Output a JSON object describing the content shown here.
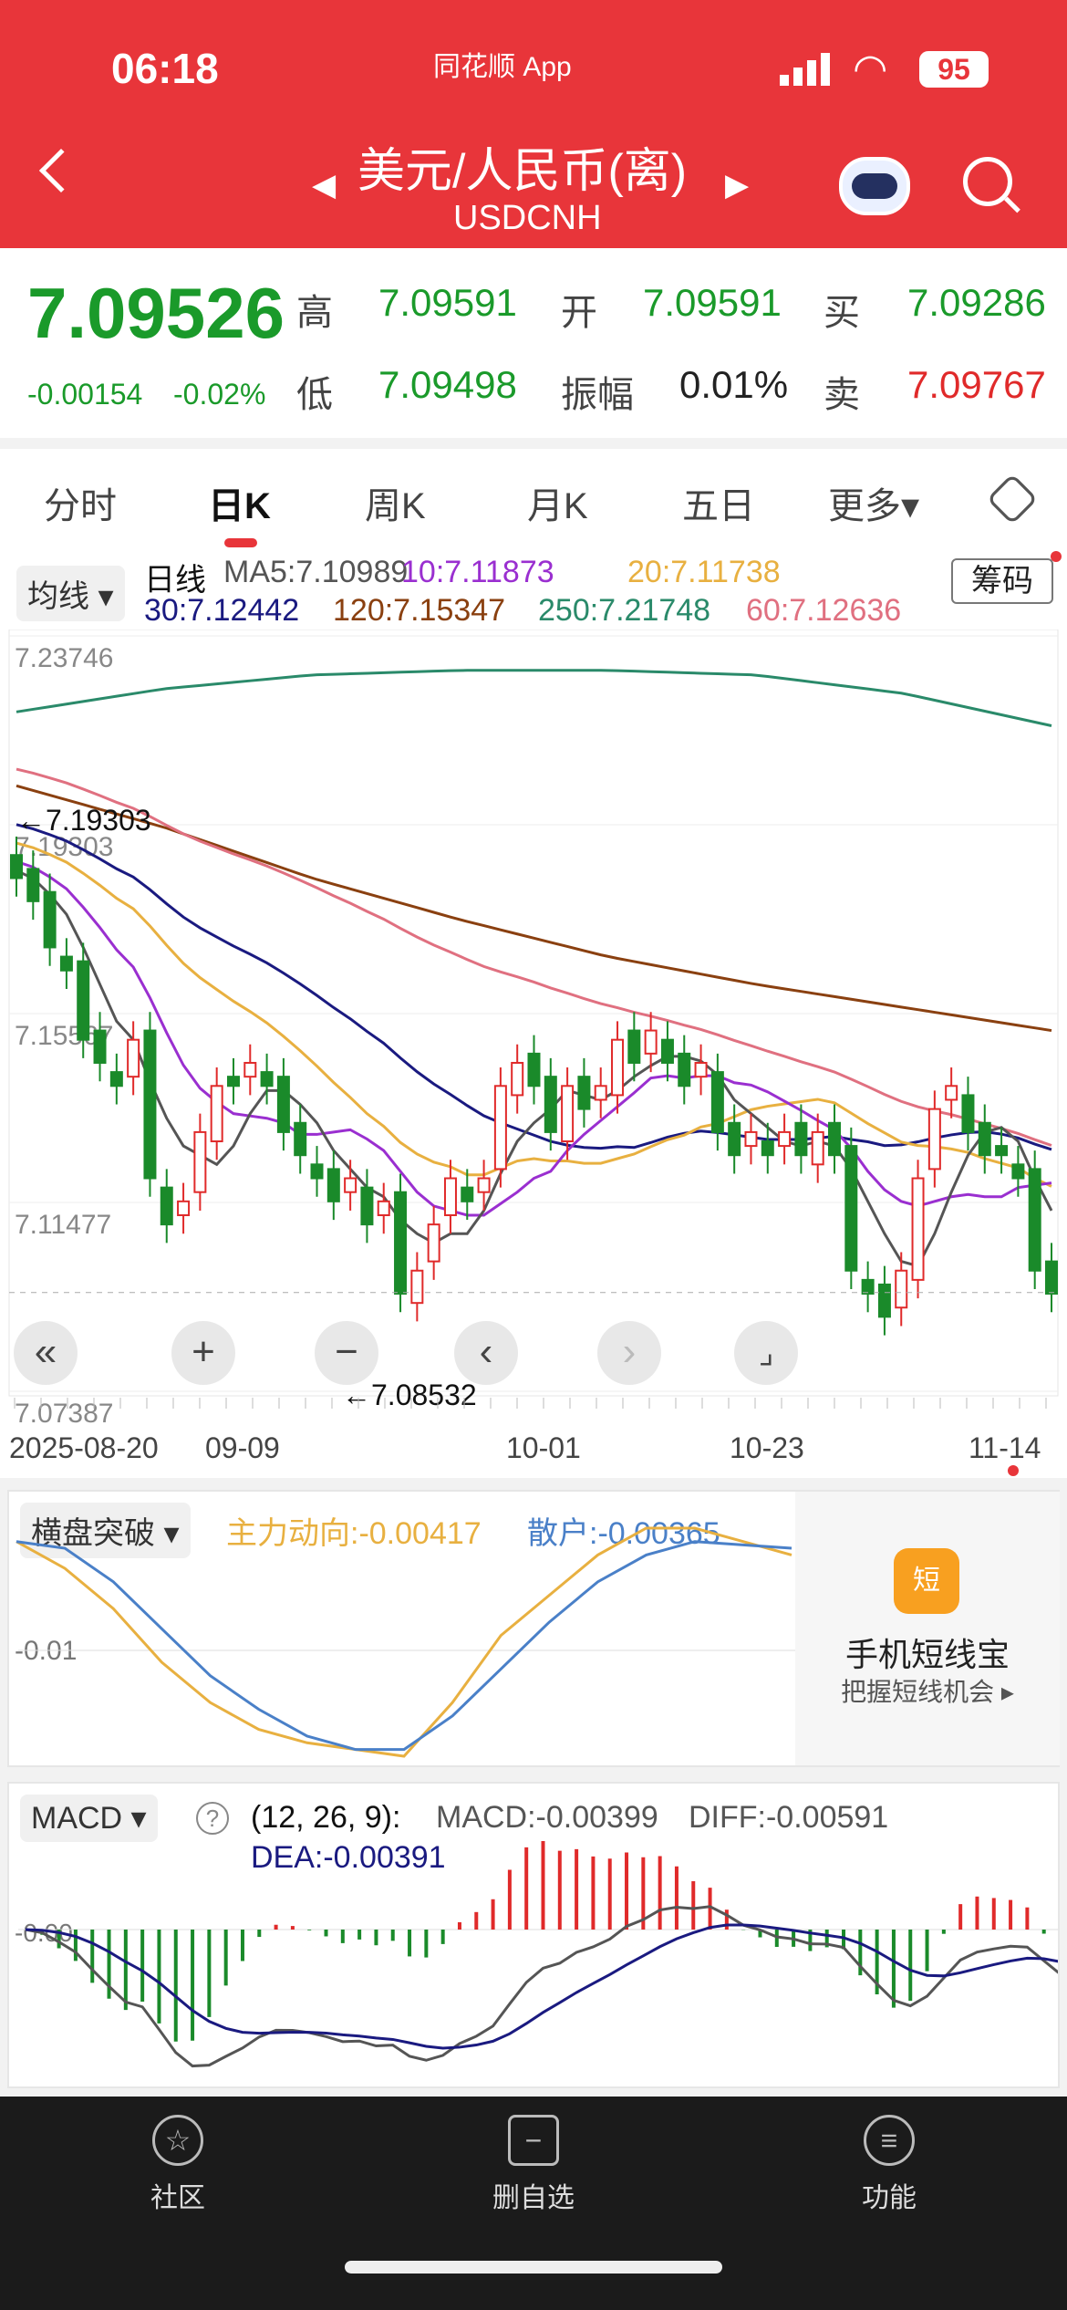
{
  "status": {
    "time": "06:18",
    "app": "同花顺 App",
    "battery": "95"
  },
  "header": {
    "title": "美元/人民币(离)",
    "code": "USDCNH"
  },
  "quote": {
    "price": "7.09526",
    "change": "-0.00154",
    "pct": "-0.02%",
    "high_label": "高",
    "high": "7.09591",
    "open_label": "开",
    "open": "7.09591",
    "bid_label": "买",
    "bid": "7.09286",
    "low_label": "低",
    "low": "7.09498",
    "amp_label": "振幅",
    "amp": "0.01%",
    "ask_label": "卖",
    "ask": "7.09767"
  },
  "tabs": [
    "分时",
    "日K",
    "周K",
    "月K",
    "五日",
    "更多▾"
  ],
  "ma": {
    "selector": "均线",
    "period": "日线",
    "ma5": "MA5:7.10989",
    "ma10": "10:7.11873",
    "ma20": "20:7.11738",
    "ma30": "30:7.12442",
    "ma120": "120:7.15347",
    "ma250": "250:7.21748",
    "ma60": "60:7.12636",
    "chips": "筹码"
  },
  "colors": {
    "up": "#e02a2a",
    "down": "#1a8a2a",
    "ma5": "#555555",
    "ma10": "#9a2fd0",
    "ma20": "#e8b040",
    "ma30": "#1a1a80",
    "ma120": "#8a4010",
    "ma250": "#2a8a6a",
    "ma60": "#e07080"
  },
  "chart_data": {
    "type": "candlestick",
    "ylim": [
      7.07387,
      7.23746
    ],
    "ylabels": [
      "7.23746",
      "7.19303",
      "7.15567",
      "7.11477",
      "7.07387"
    ],
    "max_marker": "←7.19303",
    "min_marker": "←7.08532",
    "xlabels": [
      "2025-08-20",
      "09-09",
      "10-01",
      "10-23",
      "11-14"
    ],
    "closes": [
      7.185,
      7.18,
      7.17,
      7.165,
      7.15,
      7.145,
      7.14,
      7.15,
      7.12,
      7.11,
      7.115,
      7.13,
      7.14,
      7.14,
      7.145,
      7.14,
      7.13,
      7.125,
      7.12,
      7.115,
      7.12,
      7.11,
      7.115,
      7.095,
      7.1,
      7.11,
      7.12,
      7.115,
      7.12,
      7.14,
      7.145,
      7.14,
      7.13,
      7.14,
      7.135,
      7.14,
      7.15,
      7.145,
      7.152,
      7.145,
      7.14,
      7.145,
      7.13,
      7.125,
      7.13,
      7.125,
      7.13,
      7.125,
      7.13,
      7.125,
      7.1,
      7.095,
      7.09,
      7.1,
      7.12,
      7.135,
      7.14,
      7.13,
      7.125,
      7.125,
      7.12,
      7.1,
      7.095
    ],
    "ma250": [
      7.221,
      7.226,
      7.229,
      7.23,
      7.23,
      7.229,
      7.225,
      7.218
    ],
    "ma120": [
      7.205,
      7.196,
      7.185,
      7.176,
      7.168,
      7.162,
      7.157,
      7.152
    ]
  },
  "hp": {
    "selector": "横盘突破",
    "main": "主力动向:-0.00417",
    "retail": "散户:-0.00365",
    "axis": "-0.01",
    "promo_title": "手机短线宝",
    "promo_sub": "把握短线机会 ▸",
    "promo_icon": "短",
    "main_series": [
      0.004,
      0.0,
      -0.006,
      -0.014,
      -0.02,
      -0.024,
      -0.026,
      -0.027,
      -0.028,
      -0.02,
      -0.01,
      -0.004,
      0.002,
      0.006,
      0.006,
      0.004,
      0.002
    ],
    "retail_series": [
      0.004,
      0.003,
      -0.002,
      -0.009,
      -0.016,
      -0.021,
      -0.025,
      -0.027,
      -0.027,
      -0.022,
      -0.015,
      -0.008,
      -0.002,
      0.002,
      0.004,
      0.0035,
      0.003
    ]
  },
  "macd": {
    "selector": "MACD",
    "params": "(12, 26, 9):",
    "macd": "MACD:-0.00399",
    "diff": "DIFF:-0.00591",
    "dea": "DEA:-0.00391",
    "axis": "-0.00"
  },
  "nav": [
    {
      "icon": "community-icon",
      "label": "社区"
    },
    {
      "icon": "minus-icon",
      "label": "删自选"
    },
    {
      "icon": "menu-icon",
      "label": "功能"
    }
  ]
}
